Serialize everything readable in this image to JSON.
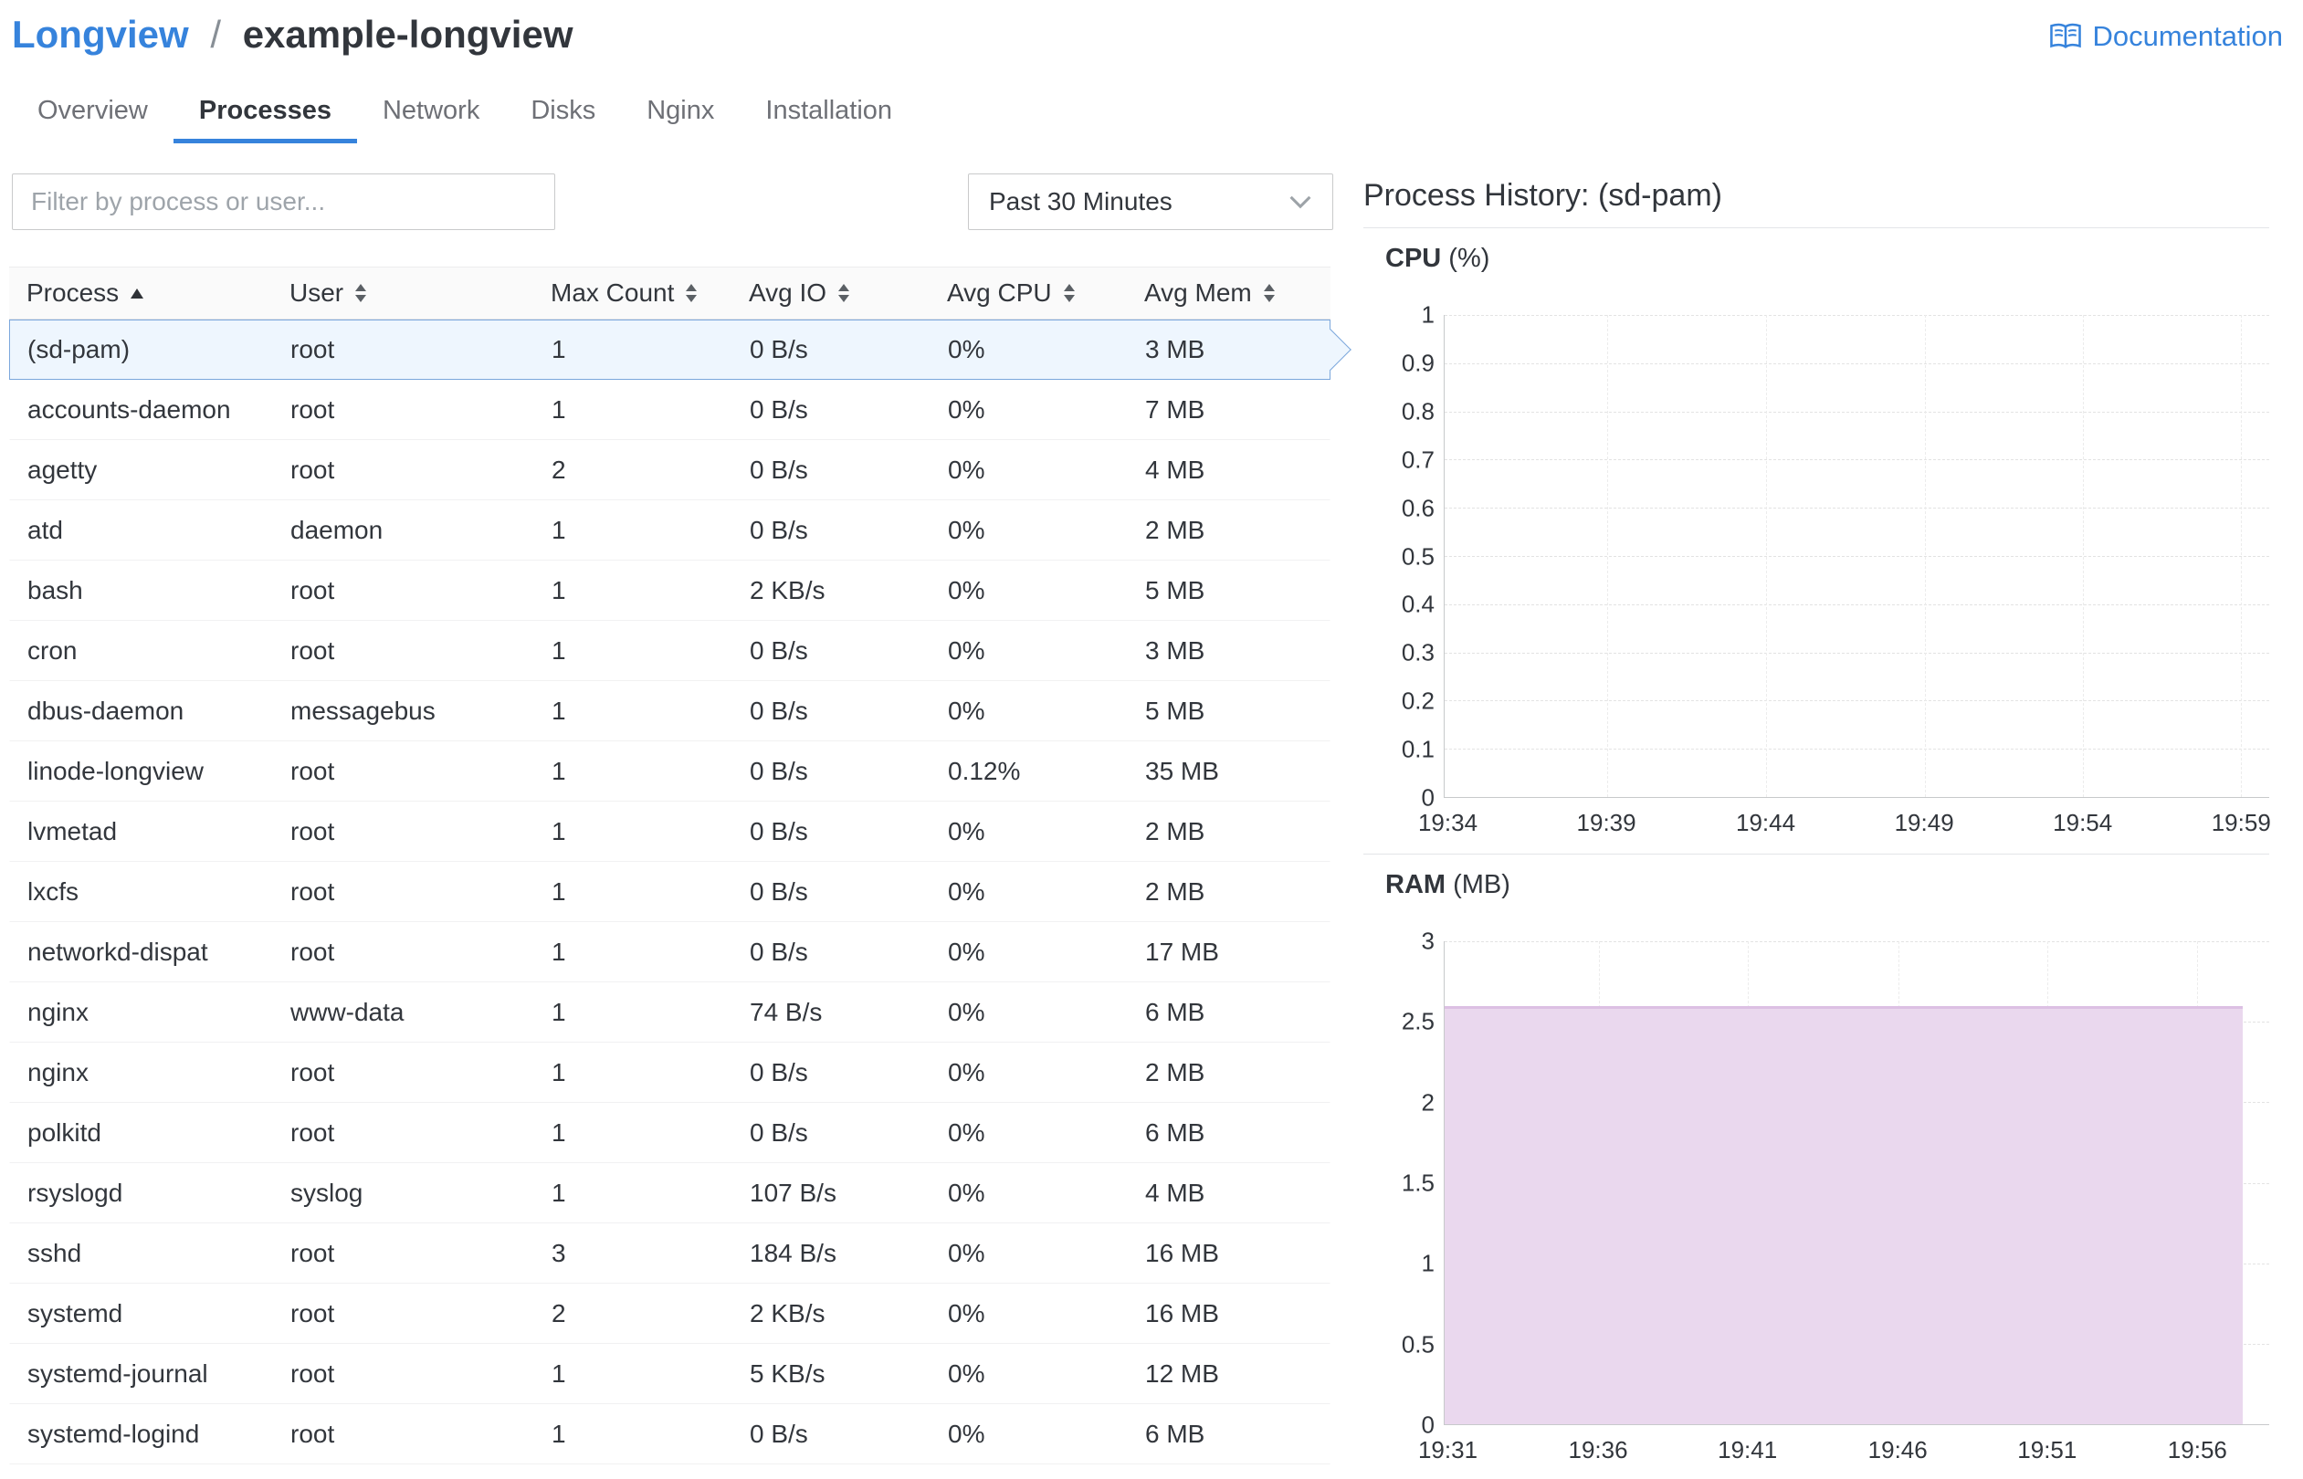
{
  "breadcrumb": {
    "parent": "Longview",
    "separator": "/",
    "current": "example-longview"
  },
  "documentation": {
    "label": "Documentation"
  },
  "tabs": [
    {
      "label": "Overview",
      "active": false
    },
    {
      "label": "Processes",
      "active": true
    },
    {
      "label": "Network",
      "active": false
    },
    {
      "label": "Disks",
      "active": false
    },
    {
      "label": "Nginx",
      "active": false
    },
    {
      "label": "Installation",
      "active": false
    }
  ],
  "filter": {
    "placeholder": "Filter by process or user..."
  },
  "time_range": {
    "selected": "Past 30 Minutes"
  },
  "process_history": {
    "title": "Process History: (sd-pam)"
  },
  "colors": {
    "accent_blue": "#3683dc",
    "selected_row_bg": "#eef6fe",
    "selected_row_border": "#7ba7dc",
    "ram_fill": "#ead8ee"
  },
  "table": {
    "columns": [
      {
        "label": "Process",
        "sort": "asc"
      },
      {
        "label": "User",
        "sort": "both"
      },
      {
        "label": "Max Count",
        "sort": "both"
      },
      {
        "label": "Avg IO",
        "sort": "both"
      },
      {
        "label": "Avg CPU",
        "sort": "both"
      },
      {
        "label": "Avg Mem",
        "sort": "both"
      }
    ],
    "rows": [
      {
        "process": "(sd-pam)",
        "user": "root",
        "max_count": "1",
        "avg_io": "0 B/s",
        "avg_cpu": "0%",
        "avg_mem": "3 MB",
        "selected": true
      },
      {
        "process": "accounts-daemon",
        "user": "root",
        "max_count": "1",
        "avg_io": "0 B/s",
        "avg_cpu": "0%",
        "avg_mem": "7 MB",
        "selected": false
      },
      {
        "process": "agetty",
        "user": "root",
        "max_count": "2",
        "avg_io": "0 B/s",
        "avg_cpu": "0%",
        "avg_mem": "4 MB",
        "selected": false
      },
      {
        "process": "atd",
        "user": "daemon",
        "max_count": "1",
        "avg_io": "0 B/s",
        "avg_cpu": "0%",
        "avg_mem": "2 MB",
        "selected": false
      },
      {
        "process": "bash",
        "user": "root",
        "max_count": "1",
        "avg_io": "2 KB/s",
        "avg_cpu": "0%",
        "avg_mem": "5 MB",
        "selected": false
      },
      {
        "process": "cron",
        "user": "root",
        "max_count": "1",
        "avg_io": "0 B/s",
        "avg_cpu": "0%",
        "avg_mem": "3 MB",
        "selected": false
      },
      {
        "process": "dbus-daemon",
        "user": "messagebus",
        "max_count": "1",
        "avg_io": "0 B/s",
        "avg_cpu": "0%",
        "avg_mem": "5 MB",
        "selected": false
      },
      {
        "process": "linode-longview",
        "user": "root",
        "max_count": "1",
        "avg_io": "0 B/s",
        "avg_cpu": "0.12%",
        "avg_mem": "35 MB",
        "selected": false
      },
      {
        "process": "lvmetad",
        "user": "root",
        "max_count": "1",
        "avg_io": "0 B/s",
        "avg_cpu": "0%",
        "avg_mem": "2 MB",
        "selected": false
      },
      {
        "process": "lxcfs",
        "user": "root",
        "max_count": "1",
        "avg_io": "0 B/s",
        "avg_cpu": "0%",
        "avg_mem": "2 MB",
        "selected": false
      },
      {
        "process": "networkd-dispat",
        "user": "root",
        "max_count": "1",
        "avg_io": "0 B/s",
        "avg_cpu": "0%",
        "avg_mem": "17 MB",
        "selected": false
      },
      {
        "process": "nginx",
        "user": "www-data",
        "max_count": "1",
        "avg_io": "74 B/s",
        "avg_cpu": "0%",
        "avg_mem": "6 MB",
        "selected": false
      },
      {
        "process": "nginx",
        "user": "root",
        "max_count": "1",
        "avg_io": "0 B/s",
        "avg_cpu": "0%",
        "avg_mem": "2 MB",
        "selected": false
      },
      {
        "process": "polkitd",
        "user": "root",
        "max_count": "1",
        "avg_io": "0 B/s",
        "avg_cpu": "0%",
        "avg_mem": "6 MB",
        "selected": false
      },
      {
        "process": "rsyslogd",
        "user": "syslog",
        "max_count": "1",
        "avg_io": "107 B/s",
        "avg_cpu": "0%",
        "avg_mem": "4 MB",
        "selected": false
      },
      {
        "process": "sshd",
        "user": "root",
        "max_count": "3",
        "avg_io": "184 B/s",
        "avg_cpu": "0%",
        "avg_mem": "16 MB",
        "selected": false
      },
      {
        "process": "systemd",
        "user": "root",
        "max_count": "2",
        "avg_io": "2 KB/s",
        "avg_cpu": "0%",
        "avg_mem": "16 MB",
        "selected": false
      },
      {
        "process": "systemd-journal",
        "user": "root",
        "max_count": "1",
        "avg_io": "5 KB/s",
        "avg_cpu": "0%",
        "avg_mem": "12 MB",
        "selected": false
      },
      {
        "process": "systemd-logind",
        "user": "root",
        "max_count": "1",
        "avg_io": "0 B/s",
        "avg_cpu": "0%",
        "avg_mem": "6 MB",
        "selected": false
      }
    ]
  },
  "chart_data": [
    {
      "type": "line",
      "title": "CPU",
      "unit": "(%)",
      "ylim": [
        0,
        1
      ],
      "yticks": [
        "1",
        "0.9",
        "0.8",
        "0.7",
        "0.6",
        "0.5",
        "0.4",
        "0.3",
        "0.2",
        "0.1",
        "0"
      ],
      "x_ticks": [
        {
          "label": "19:34",
          "pos_pct": 0.5
        },
        {
          "label": "19:39",
          "pos_pct": 19.7
        },
        {
          "label": "19:44",
          "pos_pct": 39.0
        },
        {
          "label": "19:49",
          "pos_pct": 58.2
        },
        {
          "label": "19:54",
          "pos_pct": 77.4
        },
        {
          "label": "19:59",
          "pos_pct": 96.6
        }
      ],
      "series": [
        {
          "name": "CPU",
          "values": [
            0,
            0,
            0,
            0,
            0,
            0
          ]
        }
      ],
      "grid": "dashed",
      "legend": "none"
    },
    {
      "type": "area",
      "title": "RAM",
      "unit": "(MB)",
      "ylim": [
        0,
        3
      ],
      "yticks": [
        "3",
        "2.5",
        "2",
        "1.5",
        "1",
        "0.5",
        "0"
      ],
      "x_ticks": [
        {
          "label": "19:31",
          "pos_pct": 0.5
        },
        {
          "label": "19:36",
          "pos_pct": 18.7
        },
        {
          "label": "19:41",
          "pos_pct": 36.8
        },
        {
          "label": "19:46",
          "pos_pct": 55.0
        },
        {
          "label": "19:51",
          "pos_pct": 73.1
        },
        {
          "label": "19:56",
          "pos_pct": 91.3
        }
      ],
      "series": [
        {
          "name": "RAM",
          "values": [
            2.6,
            2.6,
            2.6,
            2.6,
            2.6,
            2.6
          ]
        }
      ],
      "area": {
        "value": 2.6,
        "to_pct": 96.8,
        "fill_color": "#ead8ee",
        "line_color": "#dcc0e3"
      },
      "grid": "dashed",
      "legend": "none"
    }
  ]
}
